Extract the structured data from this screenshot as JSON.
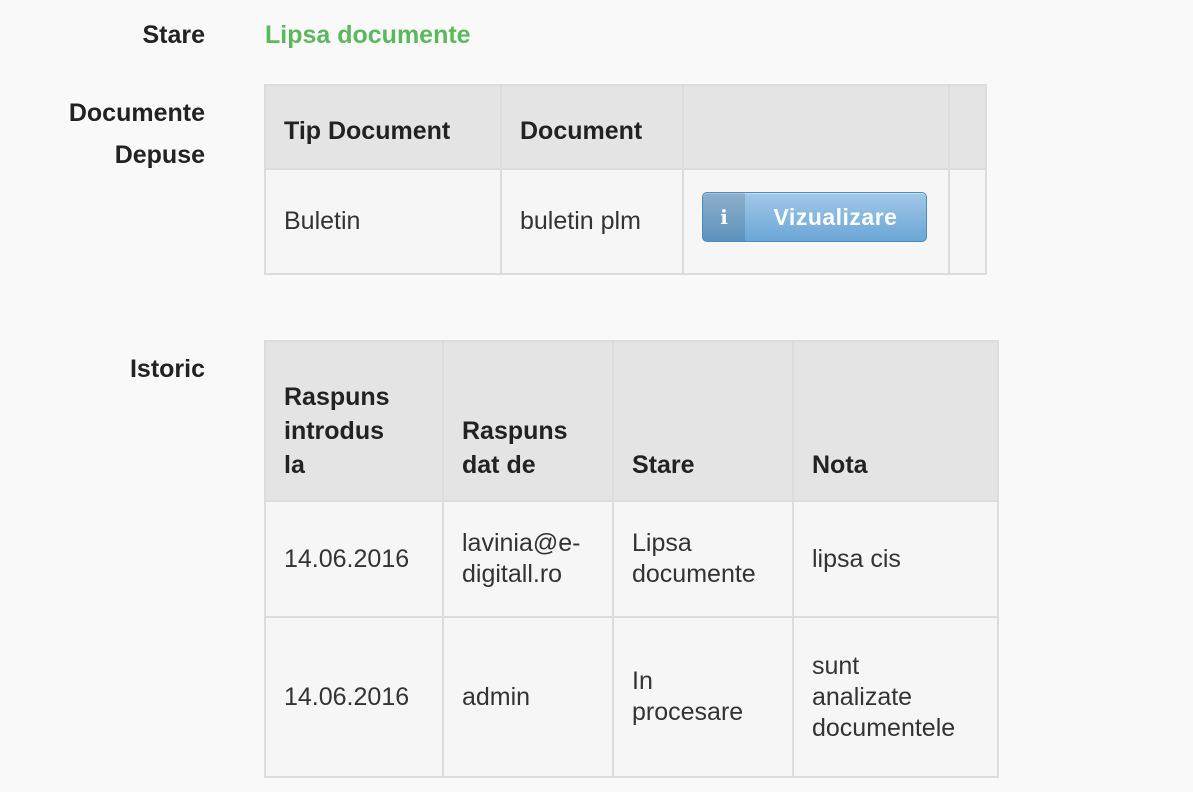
{
  "status": {
    "label": "Stare",
    "value": "Lipsa documente",
    "value_color": "#5cb85c"
  },
  "documents": {
    "label_line1": "Documente",
    "label_line2": "Depuse",
    "columns": [
      "Tip Document",
      "Document",
      "",
      ""
    ],
    "rows": [
      {
        "type": "Buletin",
        "document": "buletin plm",
        "action_label": "Vizualizare",
        "action_icon": "info-icon"
      }
    ]
  },
  "history": {
    "label": "Istoric",
    "columns": [
      [
        "Raspuns",
        "introdus",
        "la"
      ],
      [
        "Raspuns",
        "dat de"
      ],
      [
        "Stare"
      ],
      [
        "Nota"
      ]
    ],
    "rows": [
      {
        "date": "14.06.2016",
        "by": [
          "lavinia@e-",
          "digitall.ro"
        ],
        "state": [
          "Lipsa",
          "documente"
        ],
        "note": [
          "lipsa cis"
        ]
      },
      {
        "date": "14.06.2016",
        "by": [
          "admin"
        ],
        "state": [
          "In",
          "procesare"
        ],
        "note": [
          "sunt",
          "analizate",
          "documentele"
        ]
      }
    ]
  }
}
